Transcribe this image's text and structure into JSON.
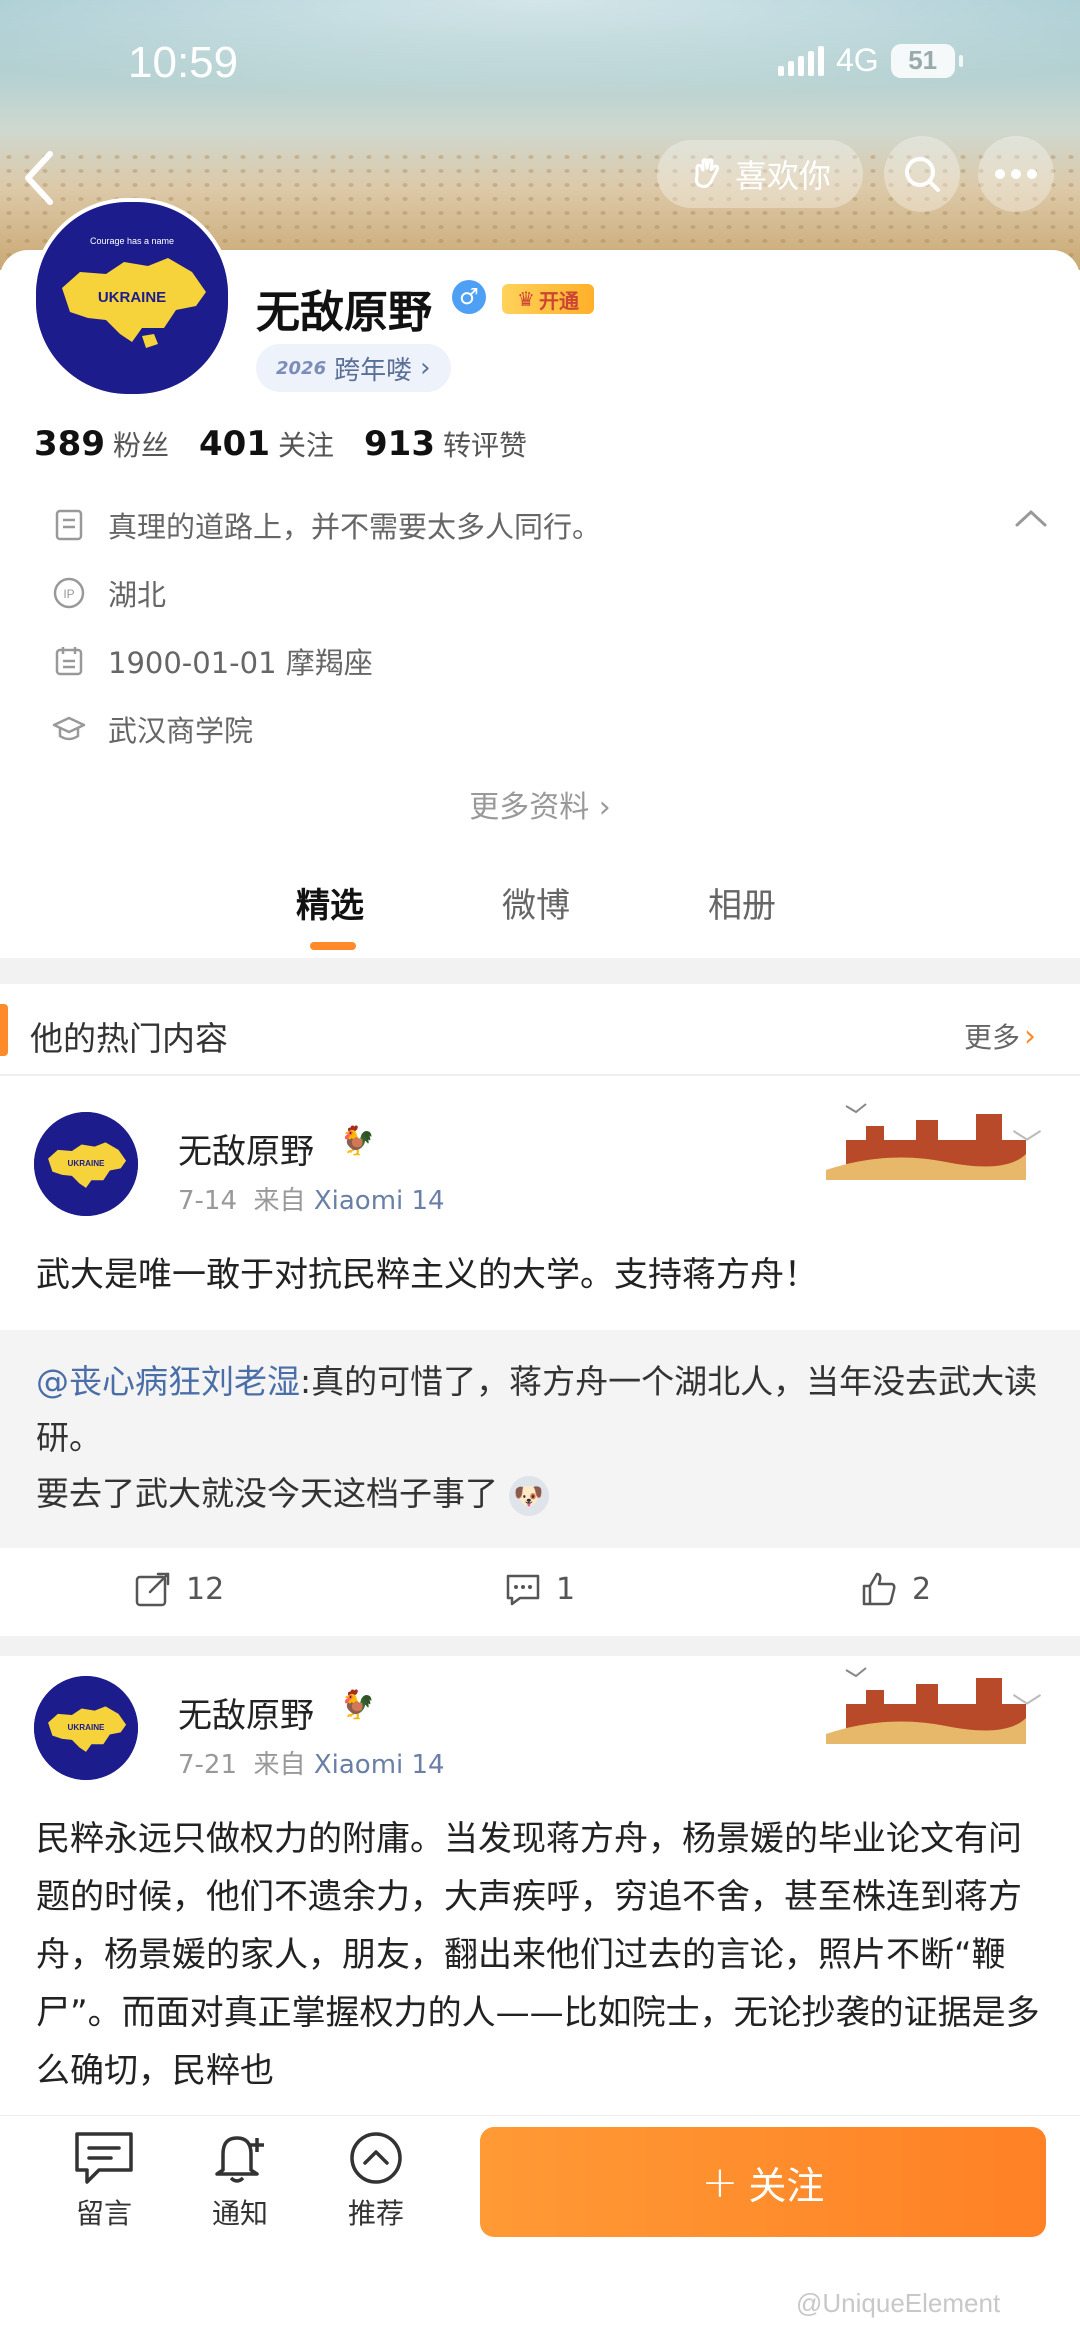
{
  "status_bar": {
    "time": "10:59",
    "network": "4G",
    "battery": "51"
  },
  "header": {
    "like_label": "喜欢你"
  },
  "avatar": {
    "top_text": "Courage has a name",
    "country": "UKRAINE"
  },
  "profile": {
    "name": "无敌原野",
    "vip_label": "开通",
    "year_tag_year": "2026",
    "year_tag": "跨年喽",
    "followers_count": "389",
    "followers_label": "粉丝",
    "following_count": "401",
    "following_label": "关注",
    "likes_count": "913",
    "likes_label": "转评赞",
    "bio": "真理的道路上，并不需要太多人同行。",
    "location": "湖北",
    "birthday": "1900-01-01 摩羯座",
    "school": "武汉商学院",
    "more_info": "更多资料"
  },
  "tabs": [
    "精选",
    "微博",
    "相册"
  ],
  "hot_section": {
    "title": "他的热门内容",
    "more": "更多"
  },
  "posts": [
    {
      "author": "无敌原野",
      "date": "7-14",
      "source_prefix": "来自",
      "source": "Xiaomi 14",
      "text": "武大是唯一敢于对抗民粹主义的大学。支持蒋方舟！",
      "repost_user": "@丧心病狂刘老湿",
      "repost_text": ":真的可惜了，蒋方舟一个湖北人，当年没去武大读研。",
      "repost_text2": "要去了武大就没今天这档子事了",
      "reposts": "12",
      "comments": "1",
      "likes": "2"
    },
    {
      "author": "无敌原野",
      "date": "7-21",
      "source_prefix": "来自",
      "source": "Xiaomi 14",
      "text": "民粹永远只做权力的附庸。当发现蒋方舟，杨景媛的毕业论文有问题的时候，他们不遗余力，大声疾呼，穷追不舍，甚至株连到蒋方舟，杨景媛的家人，朋友，翻出来他们过去的言论，照片不断“鞭尸”。而面对真正掌握权力的人——比如院士，无论抄袭的证据是多么确切，民粹也"
    }
  ],
  "bottom_bar": {
    "comment": "留言",
    "notify": "通知",
    "recommend": "推荐",
    "follow": "关注"
  },
  "watermark": "@UniqueElement"
}
